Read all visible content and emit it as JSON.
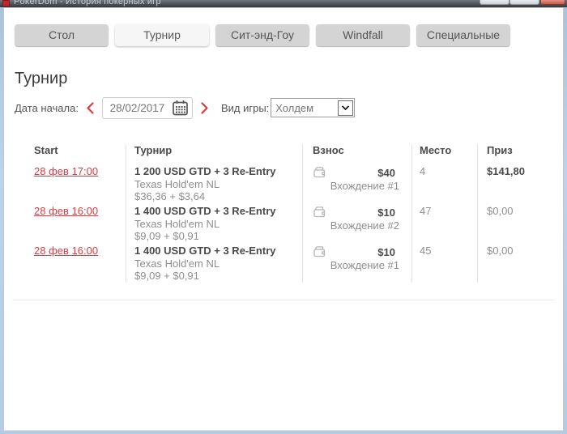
{
  "window": {
    "title": "PokerDom - История покерных игр"
  },
  "tabs": [
    {
      "label": "Стол",
      "active": false
    },
    {
      "label": "Турнир",
      "active": true
    },
    {
      "label": "Сит-энд-Гоу",
      "active": false
    },
    {
      "label": "Windfall",
      "active": false
    },
    {
      "label": "Специальные",
      "active": false
    }
  ],
  "page": {
    "heading": "Турнир"
  },
  "filters": {
    "date_label": "Дата начала:",
    "date_value": "28/02/2017",
    "game_type_label": "Вид игры:",
    "game_type_value": "Холдем"
  },
  "table": {
    "headers": {
      "start": "Start",
      "tournament": "Турнир",
      "buyin": "Взнос",
      "place": "Место",
      "prize": "Приз"
    },
    "rows": [
      {
        "start": "28 фев 17:00",
        "name": "1 200 USD GTD + 3 Re-Entry",
        "game": "Texas Hold'em NL",
        "buyin_split": "$36,36 + $3,64",
        "buyin": "$40",
        "entry": "Вхождение #1",
        "place": "4",
        "prize": "$141,80"
      },
      {
        "start": "28 фев 16:00",
        "name": "1 400 USD GTD + 3 Re-Entry",
        "game": "Texas Hold'em NL",
        "buyin_split": "$9,09 + $0,91",
        "buyin": "$10",
        "entry": "Вхождение #2",
        "place": "47",
        "prize": "$0,00"
      },
      {
        "start": "28 фев 16:00",
        "name": "1 400 USD GTD + 3 Re-Entry",
        "game": "Texas Hold'em NL",
        "buyin_split": "$9,09 + $0,91",
        "buyin": "$10",
        "entry": "Вхождение #1",
        "place": "45",
        "prize": "$0,00"
      }
    ]
  },
  "icons": [
    "app-icon",
    "minimize-button",
    "maximize-button",
    "close-button",
    "chevron-left-icon",
    "chevron-right-icon",
    "calendar-icon",
    "dropdown-arrow-icon",
    "wallet-icon"
  ],
  "colors": {
    "accent_red": "#dd3b40",
    "tab_gray": "#d4d4d4",
    "tab_active": "#f6f6f6",
    "text_dark": "#4a4a4a",
    "text_gray": "#8e8e8e",
    "separator": "#e3e3e3",
    "titlebar_dark": "#3c4047",
    "frame_blue": "#b3cbe4"
  }
}
